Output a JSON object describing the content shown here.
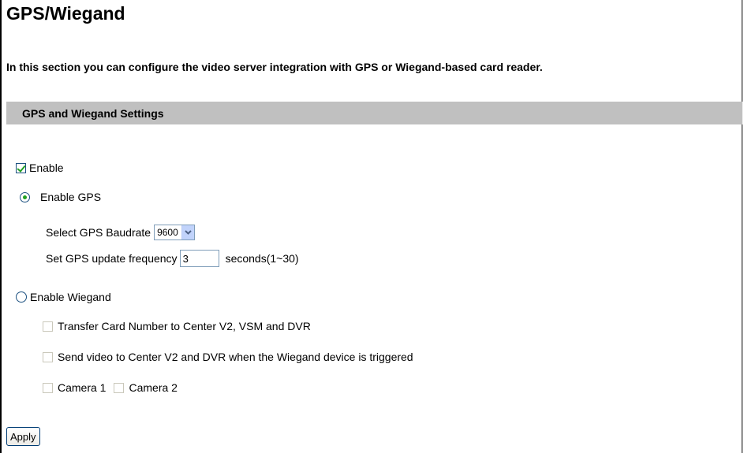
{
  "page": {
    "title": "GPS/Wiegand",
    "description": "In this section you can configure the video server integration with GPS or Wiegand-based card reader."
  },
  "section": {
    "header": "GPS and Wiegand Settings"
  },
  "form": {
    "enable": {
      "label": "Enable",
      "checked": true
    },
    "gps": {
      "label": "Enable GPS",
      "selected": true,
      "baudrate_label": "Select GPS Baudrate",
      "baudrate_value": "9600",
      "frequency_label": "Set GPS update frequency",
      "frequency_value": "3",
      "frequency_unit": "seconds(1~30)"
    },
    "wiegand": {
      "label": "Enable Wiegand",
      "selected": false,
      "transfer_label": "Transfer Card Number to Center V2, VSM and DVR",
      "send_video_label": "Send video to Center V2 and DVR when the Wiegand device is triggered",
      "camera1_label": "Camera 1",
      "camera2_label": "Camera 2"
    }
  },
  "buttons": {
    "apply": "Apply"
  },
  "colors": {
    "section_header_bg": "#c0c0c0",
    "check_mark": "#21a121"
  }
}
